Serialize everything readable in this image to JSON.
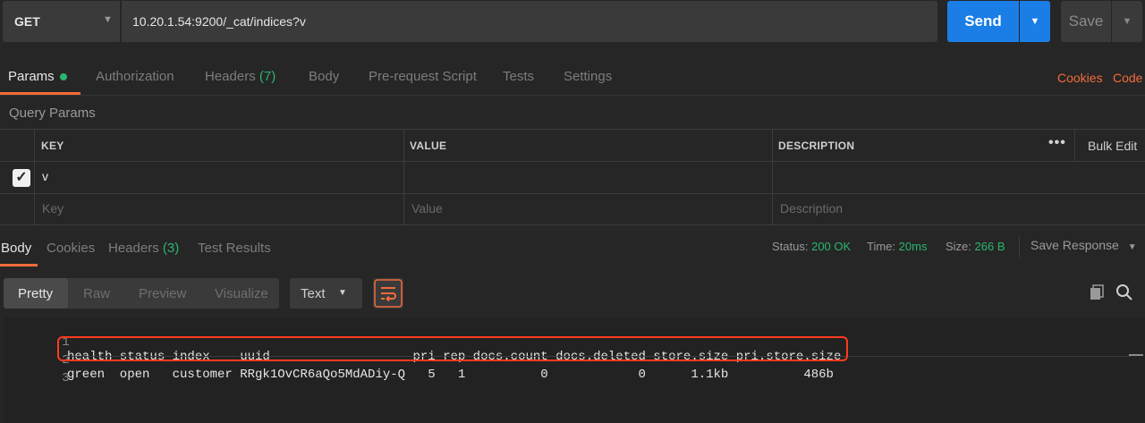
{
  "request": {
    "method": "GET",
    "url": "10.20.1.54:9200/_cat/indices?v",
    "send_label": "Send",
    "save_label": "Save"
  },
  "request_tabs": {
    "params": "Params",
    "authorization": "Authorization",
    "headers": "Headers",
    "headers_count": "(7)",
    "body": "Body",
    "prerequest": "Pre-request Script",
    "tests": "Tests",
    "settings": "Settings",
    "cookies": "Cookies",
    "code": "Code"
  },
  "query_params": {
    "title": "Query Params",
    "columns": {
      "key": "KEY",
      "value": "VALUE",
      "description": "DESCRIPTION"
    },
    "bulk_edit": "Bulk Edit",
    "rows": [
      {
        "key": "v",
        "value": "",
        "description": "",
        "checked": true
      }
    ],
    "placeholders": {
      "key": "Key",
      "value": "Value",
      "description": "Description"
    }
  },
  "response": {
    "tabs": {
      "body": "Body",
      "cookies": "Cookies",
      "headers": "Headers",
      "headers_count": "(3)",
      "test_results": "Test Results"
    },
    "status_label": "Status:",
    "status_value": "200 OK",
    "time_label": "Time:",
    "time_value": "20ms",
    "size_label": "Size:",
    "size_value": "266 B",
    "save_response": "Save Response",
    "view_modes": [
      "Pretty",
      "Raw",
      "Preview",
      "Visualize"
    ],
    "format": "Text",
    "lines": [
      {
        "n": "1",
        "text": "health status index    uuid                   pri rep docs.count docs.deleted store.size pri.store.size"
      },
      {
        "n": "2",
        "text": "green  open   customer RRgk1OvCR6aQo5MdADiy-Q   5   1          0            0      1.1kb          486b"
      },
      {
        "n": "3",
        "text": ""
      }
    ]
  },
  "colors": {
    "accent": "#f26b3a",
    "primary": "#1a7ee6",
    "success": "#2bb56e",
    "highlight": "#ff3b1f"
  }
}
